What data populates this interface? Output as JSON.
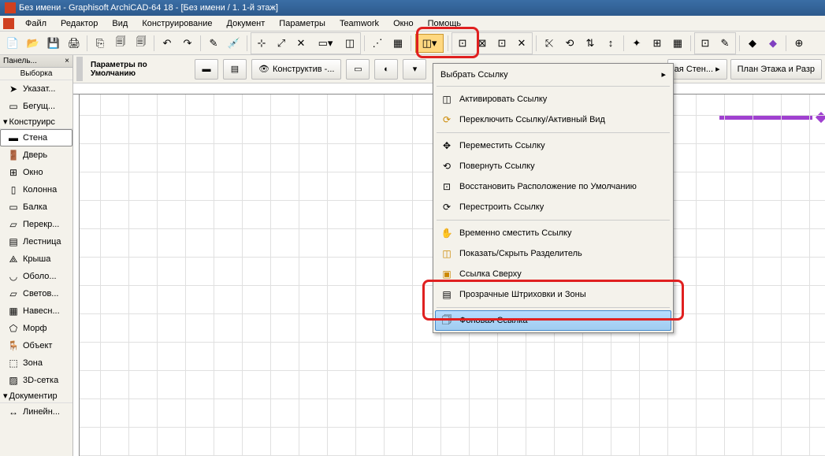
{
  "title": "Без имени - Graphisoft ArchiCAD-64 18 - [Без имени / 1. 1-й этаж]",
  "menu": {
    "file": "Файл",
    "editor": "Редактор",
    "view": "Вид",
    "construct": "Конструирование",
    "document": "Документ",
    "params": "Параметры",
    "teamwork": "Teamwork",
    "window": "Окно",
    "help": "Помощь"
  },
  "toolbox": {
    "header": "Панель...",
    "selection": "Выборка",
    "cursor": "Указат...",
    "marquee": "Бегущ...",
    "design_section": "Конструирс",
    "items": [
      "Стена",
      "Дверь",
      "Окно",
      "Колонна",
      "Балка",
      "Перекр...",
      "Лестница",
      "Крыша",
      "Оболо...",
      "Светов...",
      "Навесн...",
      "Морф",
      "Объект",
      "Зона",
      "3D-сетка"
    ],
    "document_section": "Документир",
    "linear": "Линейн..."
  },
  "info": {
    "label": "Параметры по Умолчанию",
    "layer_btn": "Конструктив -..."
  },
  "right_buttons": {
    "wall": "ая Стен... ▸",
    "plan": "План Этажа и Разр"
  },
  "dropdown": {
    "select": "Выбрать Ссылку",
    "activate": "Активировать Ссылку",
    "toggle": "Переключить Ссылку/Активный Вид",
    "move": "Переместить Ссылку",
    "rotate": "Повернуть Ссылку",
    "restore": "Восстановить Расположение по Умолчанию",
    "rebuild": "Перестроить Ссылку",
    "temp_shift": "Временно сместить Ссылку",
    "show_divider": "Показать/Скрыть Разделитель",
    "ref_above": "Ссылка Сверху",
    "transparent": "Прозрачные Штриховки и Зоны",
    "background": "Фоновая Ссылка"
  }
}
